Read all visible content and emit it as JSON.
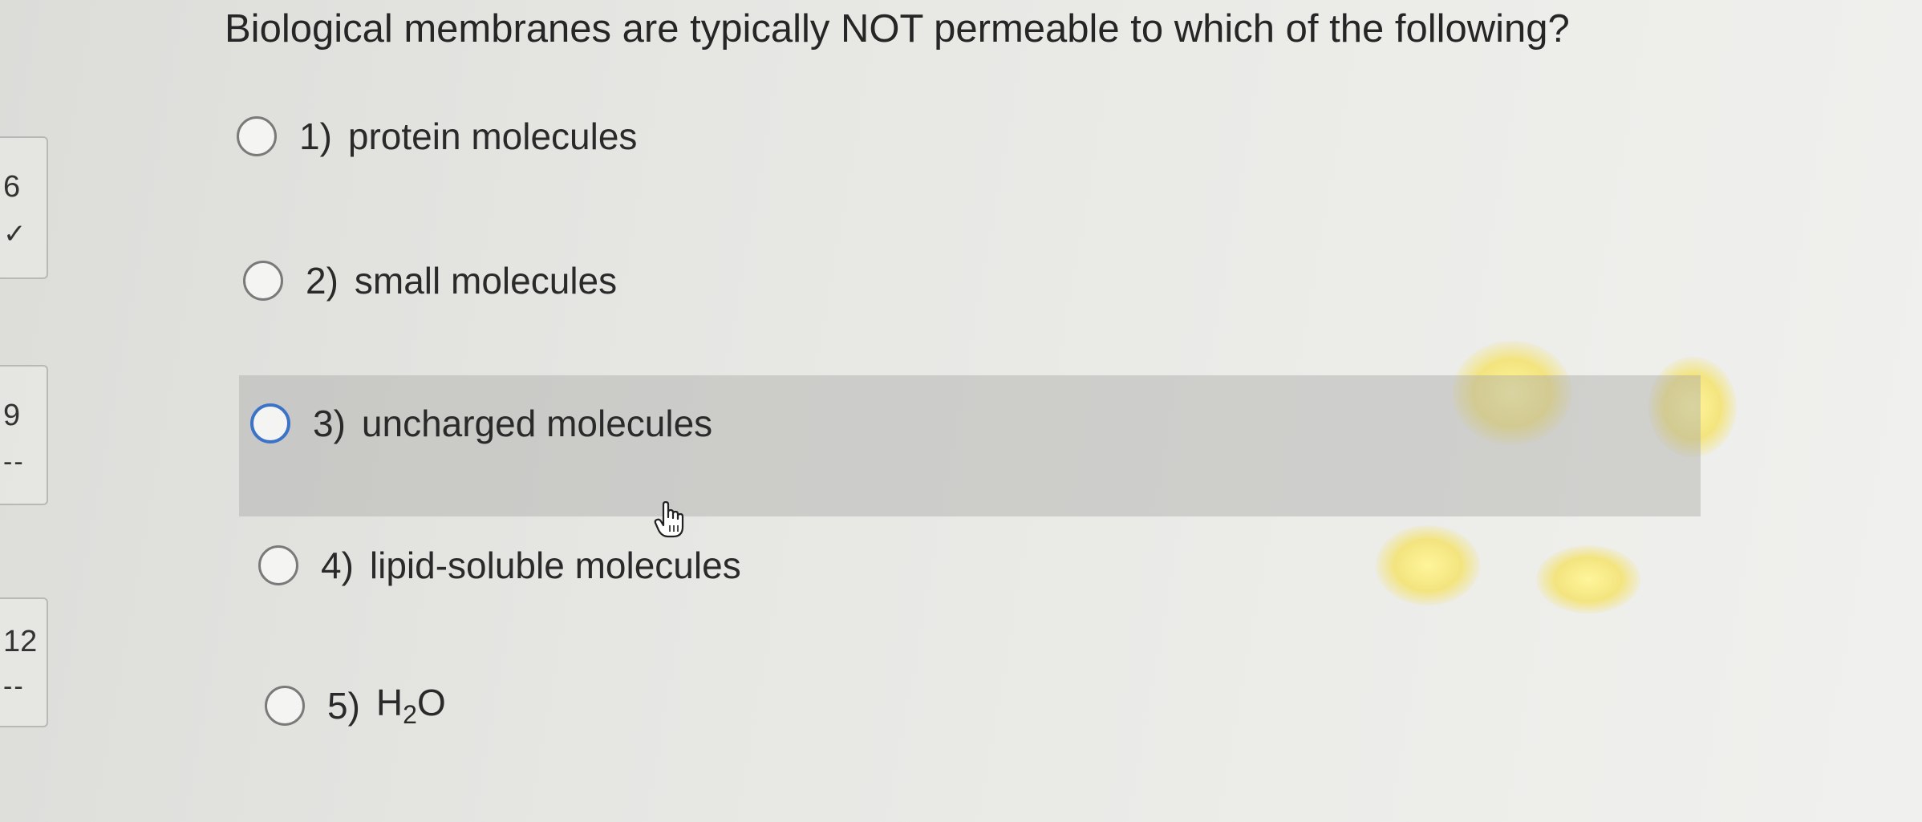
{
  "question": {
    "text": "Biological membranes are typically NOT permeable to which of the following?"
  },
  "question_nav": [
    {
      "number": "6",
      "status": "✓"
    },
    {
      "number": "9",
      "status": "--"
    },
    {
      "number": "12",
      "status": "--"
    }
  ],
  "options": [
    {
      "number": "1)",
      "label": "protein molecules"
    },
    {
      "number": "2)",
      "label": "small molecules"
    },
    {
      "number": "3)",
      "label": "uncharged molecules"
    },
    {
      "number": "4)",
      "label": "lipid-soluble molecules"
    },
    {
      "number": "5)",
      "label_main": "H",
      "label_sub": "2",
      "label_end": "O"
    }
  ],
  "colors": {
    "hover_highlight": "#aaaaa8",
    "radio_hover_border": "#3b73c9",
    "radio_border": "#7a7a7a"
  },
  "icons": {
    "cursor": "hand-pointer-icon"
  }
}
